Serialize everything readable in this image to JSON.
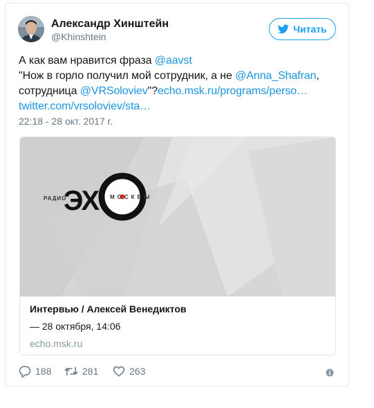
{
  "author": {
    "name": "Александр Хинштейн",
    "handle": "@Khinshtein"
  },
  "follow_button": {
    "label": "Читать",
    "icon": "twitter-bird-icon"
  },
  "tweet_text": {
    "line1_text": "А как вам нравится фраза ",
    "line1_mention": "@aavst",
    "line2_text": "\"Нож в горло получил мой сотрудник, а не ",
    "line2_mention": "@Anna_Shafran",
    "line2_punct": ",",
    "line3_text": "сотрудница ",
    "line3_mention": "@VRSoloviev",
    "line3_quote": "\"?",
    "line3_link": "echo.msk.ru/programs/perso…",
    "line4_link": "twitter.com/vrsoloviev/sta…"
  },
  "timestamp": "22:18 - 28 окт. 2017 г.",
  "card": {
    "logo_left": "РАДИО",
    "logo_main": "ЭХ",
    "logo_right": "МОСКВЫ",
    "title": "Интервью / Алексей Венедиктов",
    "description": " — 28 октября, 14:06",
    "domain": "echo.msk.ru"
  },
  "actions": {
    "replies": "188",
    "retweets": "281",
    "likes": "263",
    "reply_icon": "reply-icon",
    "retweet_icon": "retweet-icon",
    "like_icon": "heart-icon",
    "info_icon": "info-icon"
  },
  "colors": {
    "accent": "#1da1f2",
    "link": "#1b95e0",
    "secondary_text": "#657786",
    "border": "#e1e8ed",
    "logo_red": "#e2231a"
  }
}
